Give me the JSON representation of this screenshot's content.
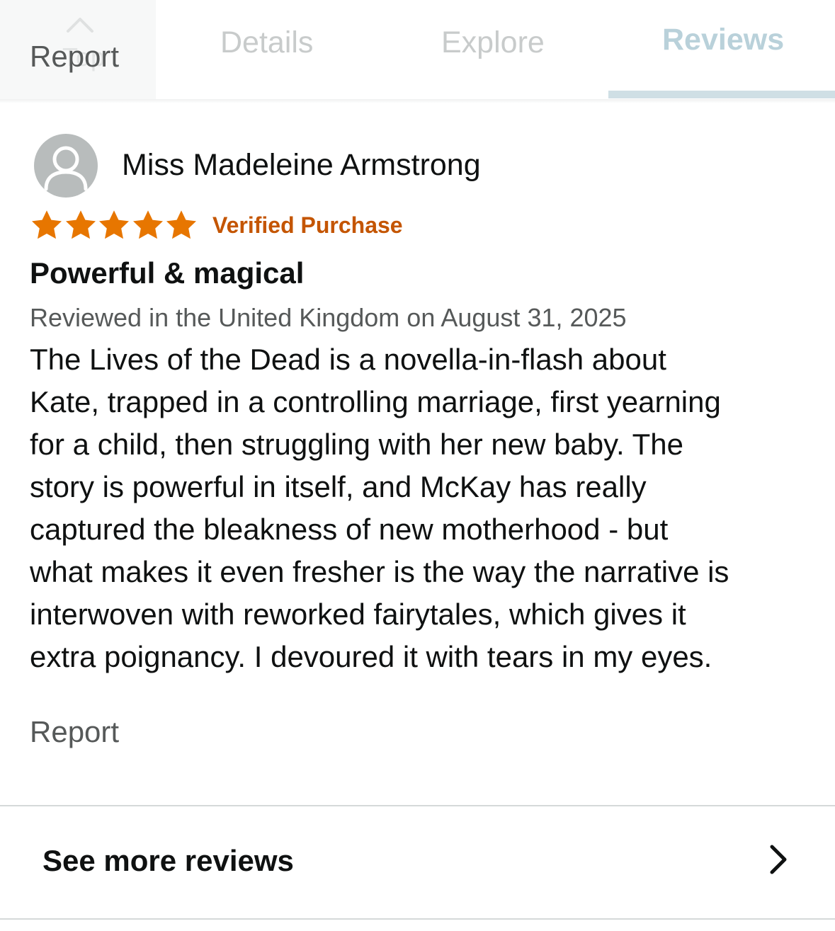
{
  "tabs": {
    "top_label": "Top",
    "report_overlay": "Report",
    "items": [
      {
        "label": "Details",
        "active": false
      },
      {
        "label": "Explore",
        "active": false
      },
      {
        "label": "Reviews",
        "active": true
      }
    ]
  },
  "review": {
    "reviewer_name": "Miss Madeleine Armstrong",
    "rating": 5,
    "rating_max": 5,
    "verified_label": "Verified Purchase",
    "title": "Powerful & magical",
    "date_line": "Reviewed in the United Kingdom on August 31, 2025",
    "body_lines": [
      "The Lives of the Dead is a novella-in-flash about",
      "Kate, trapped in a controlling marriage, first yearning",
      "for a child, then struggling with her new baby. The",
      "story is powerful in itself, and McKay has really",
      "captured the bleakness of new motherhood - but",
      "what makes it even fresher is the way the narrative is",
      "interwoven with reworked fairytales, which gives it",
      "extra poignancy. I devoured it with tears in my eyes."
    ],
    "report_label": "Report"
  },
  "footer": {
    "see_more_label": "See more reviews"
  },
  "colors": {
    "star": "#e77600",
    "verified": "#c45500",
    "active_tab": "#b9d1da",
    "muted_text": "#565959"
  },
  "icons": {
    "avatar": "person-silhouette",
    "top": "chevron-up-icon",
    "see_more": "chevron-right-icon"
  }
}
